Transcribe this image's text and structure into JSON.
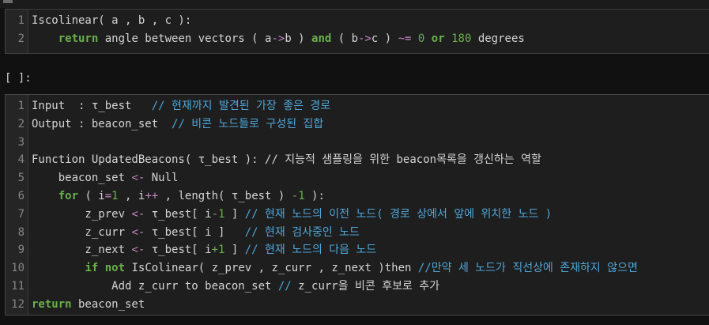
{
  "prompt": "[ ]:",
  "cell1": {
    "lines": [
      {
        "num": "1",
        "parts": [
          {
            "t": "Iscolinear( a , b , c ):",
            "c": "plain"
          }
        ]
      },
      {
        "num": "2",
        "parts": [
          {
            "t": "    ",
            "c": "plain"
          },
          {
            "t": "return",
            "c": "kw"
          },
          {
            "t": " angle between vectors ( a",
            "c": "plain"
          },
          {
            "t": "->",
            "c": "op"
          },
          {
            "t": "b ) ",
            "c": "plain"
          },
          {
            "t": "and",
            "c": "kw"
          },
          {
            "t": " ( b",
            "c": "plain"
          },
          {
            "t": "->",
            "c": "op"
          },
          {
            "t": "c ) ",
            "c": "plain"
          },
          {
            "t": "~=",
            "c": "op"
          },
          {
            "t": " ",
            "c": "plain"
          },
          {
            "t": "0",
            "c": "num"
          },
          {
            "t": " ",
            "c": "plain"
          },
          {
            "t": "or",
            "c": "kw"
          },
          {
            "t": " ",
            "c": "plain"
          },
          {
            "t": "180",
            "c": "num"
          },
          {
            "t": " degrees",
            "c": "plain"
          }
        ]
      }
    ]
  },
  "cell2": {
    "lines": [
      {
        "num": "1",
        "parts": [
          {
            "t": "Input  : τ_best   ",
            "c": "plain"
          },
          {
            "t": "// 현재까지 발견된 가장 좋은 경로",
            "c": "cm"
          }
        ]
      },
      {
        "num": "2",
        "parts": [
          {
            "t": "Output : beacon_set  ",
            "c": "plain"
          },
          {
            "t": "// 비콘 노드들로 구성된 집합",
            "c": "cm"
          }
        ]
      },
      {
        "num": "3",
        "parts": []
      },
      {
        "num": "4",
        "parts": [
          {
            "t": "Function UpdatedBeacons( τ_best ): // 지능적 샘플링을 위한 beacon목록을 갱신하는 역할",
            "c": "plain"
          }
        ]
      },
      {
        "num": "5",
        "parts": [
          {
            "t": "    beacon_set ",
            "c": "plain"
          },
          {
            "t": "<-",
            "c": "op"
          },
          {
            "t": " Null",
            "c": "plain"
          }
        ]
      },
      {
        "num": "6",
        "parts": [
          {
            "t": "    ",
            "c": "plain"
          },
          {
            "t": "for",
            "c": "kw"
          },
          {
            "t": " ( i",
            "c": "plain"
          },
          {
            "t": "=",
            "c": "op"
          },
          {
            "t": "1",
            "c": "num"
          },
          {
            "t": " , i",
            "c": "plain"
          },
          {
            "t": "++",
            "c": "op"
          },
          {
            "t": " , length( τ_best ) ",
            "c": "plain"
          },
          {
            "t": "-1",
            "c": "num"
          },
          {
            "t": " ):",
            "c": "plain"
          }
        ]
      },
      {
        "num": "7",
        "parts": [
          {
            "t": "        z_prev ",
            "c": "plain"
          },
          {
            "t": "<-",
            "c": "op"
          },
          {
            "t": " τ_best[ i",
            "c": "plain"
          },
          {
            "t": "-1",
            "c": "num"
          },
          {
            "t": " ] ",
            "c": "plain"
          },
          {
            "t": "// 현재 노드의 이전 노드( 경로 상에서 앞에 위치한 노드 )",
            "c": "cm"
          }
        ]
      },
      {
        "num": "8",
        "parts": [
          {
            "t": "        z_curr ",
            "c": "plain"
          },
          {
            "t": "<-",
            "c": "op"
          },
          {
            "t": " τ_best[ i ]   ",
            "c": "plain"
          },
          {
            "t": "// 현재 검사중인 노드",
            "c": "cm"
          }
        ]
      },
      {
        "num": "9",
        "parts": [
          {
            "t": "        z_next ",
            "c": "plain"
          },
          {
            "t": "<-",
            "c": "op"
          },
          {
            "t": " τ_best[ i",
            "c": "plain"
          },
          {
            "t": "+1",
            "c": "num"
          },
          {
            "t": " ] ",
            "c": "plain"
          },
          {
            "t": "// 현재 노드의 다음 노드",
            "c": "cm"
          }
        ]
      },
      {
        "num": "10",
        "parts": [
          {
            "t": "        ",
            "c": "plain"
          },
          {
            "t": "if",
            "c": "kw"
          },
          {
            "t": " ",
            "c": "plain"
          },
          {
            "t": "not",
            "c": "kw"
          },
          {
            "t": " IsColinear( z_prev , z_curr , z_next )then ",
            "c": "plain"
          },
          {
            "t": "//만약 세 노드가 직선상에 존재하지 않으면",
            "c": "cm"
          }
        ]
      },
      {
        "num": "11",
        "parts": [
          {
            "t": "            Add z_curr to beacon_set ",
            "c": "plain"
          },
          {
            "t": "//",
            "c": "cm"
          },
          {
            "t": " z_curr을 비콘 후보로 추가",
            "c": "plain"
          }
        ]
      },
      {
        "num": "12",
        "parts": [
          {
            "t": "return",
            "c": "kw"
          },
          {
            "t": " beacon_set",
            "c": "plain"
          }
        ]
      }
    ]
  },
  "colors": {
    "background": "#111111",
    "cell_bg": "#1e1e1e",
    "keyword": "#6ab04c",
    "operator": "#c586c0",
    "comment": "#4fa6d8",
    "text": "#d4d4d4"
  }
}
